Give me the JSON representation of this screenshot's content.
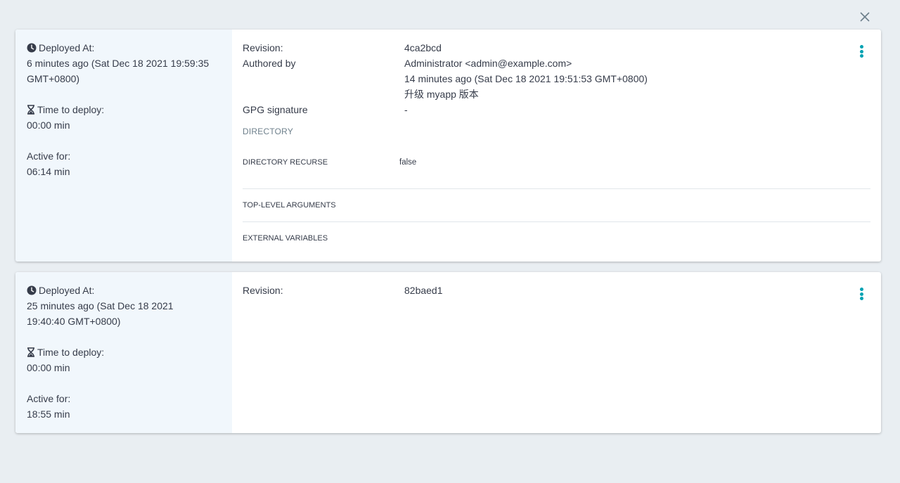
{
  "dialog": {
    "close_icon": "close-icon"
  },
  "deployments": [
    {
      "deployed_at_label": "Deployed At:",
      "deployed_at_value": "6 minutes ago (Sat Dec 18 2021 19:59:35 GMT+0800)",
      "time_to_deploy_label": "Time to deploy:",
      "time_to_deploy_value": "00:00 min",
      "active_for_label": "Active for:",
      "active_for_value": "06:14 min",
      "revision_label": "Revision:",
      "revision_value": "4ca2bcd",
      "authored_label": "Authored by",
      "author": "Administrator <admin@example.com>",
      "authored_time": "14 minutes ago (Sat Dec 18 2021 19:51:53 GMT+0800)",
      "commit_message": "升级 myapp 版本",
      "gpg_label": "GPG signature",
      "gpg_value": "-",
      "directory_title": "DIRECTORY",
      "directory_rows": [
        {
          "key": "DIRECTORY RECURSE",
          "value": "false"
        },
        {
          "key": "TOP-LEVEL ARGUMENTS",
          "value": ""
        },
        {
          "key": "EXTERNAL VARIABLES",
          "value": ""
        }
      ]
    },
    {
      "deployed_at_label": "Deployed At:",
      "deployed_at_value": "25 minutes ago (Sat Dec 18 2021 19:40:40 GMT+0800)",
      "time_to_deploy_label": "Time to deploy:",
      "time_to_deploy_value": "00:00 min",
      "active_for_label": "Active for:",
      "active_for_value": "18:55 min",
      "revision_label": "Revision:",
      "revision_value": "82baed1"
    }
  ],
  "colors": {
    "accent": "#00a2b3",
    "page_bg": "#e9eef2",
    "left_panel_bg": "#f1f7fc"
  }
}
